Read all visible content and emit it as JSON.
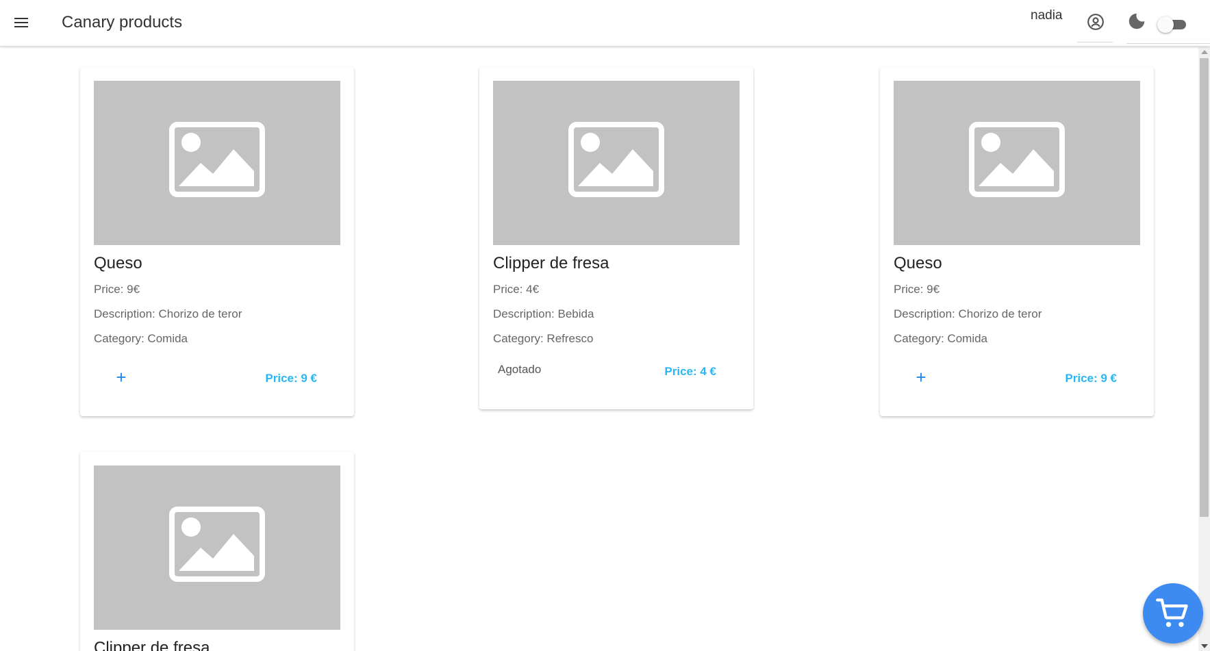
{
  "header": {
    "title": "Canary products",
    "user_name": "nadia"
  },
  "products": [
    {
      "name": "Queso",
      "price_line": "Price: 9€",
      "description": "Description: Chorizo de teror",
      "category": "Category: Comida",
      "price_button": "Price: 9 €",
      "add_label": "+"
    },
    {
      "name": "Clipper de fresa",
      "price_line": "Price: 4€",
      "description": "Description: Bebida",
      "category": "Category: Refresco",
      "status": "Agotado",
      "price_button": "Price: 4 €"
    },
    {
      "name": "Queso",
      "price_line": "Price: 9€",
      "description": "Description: Chorizo de teror",
      "category": "Category: Comida",
      "price_button": "Price: 9 €",
      "add_label": "+"
    },
    {
      "name": "Clipper de fresa"
    }
  ],
  "colors": {
    "accent_blue": "#1e88e5",
    "price_blue": "#29b6f6",
    "fab_blue": "#3d8bf0",
    "placeholder_gray": "#c2c2c2"
  },
  "icons": {
    "menu": "menu-icon",
    "account": "account-circle-icon",
    "theme": "moon-icon",
    "cart": "shopping-cart-icon",
    "image": "image-placeholder-icon"
  }
}
